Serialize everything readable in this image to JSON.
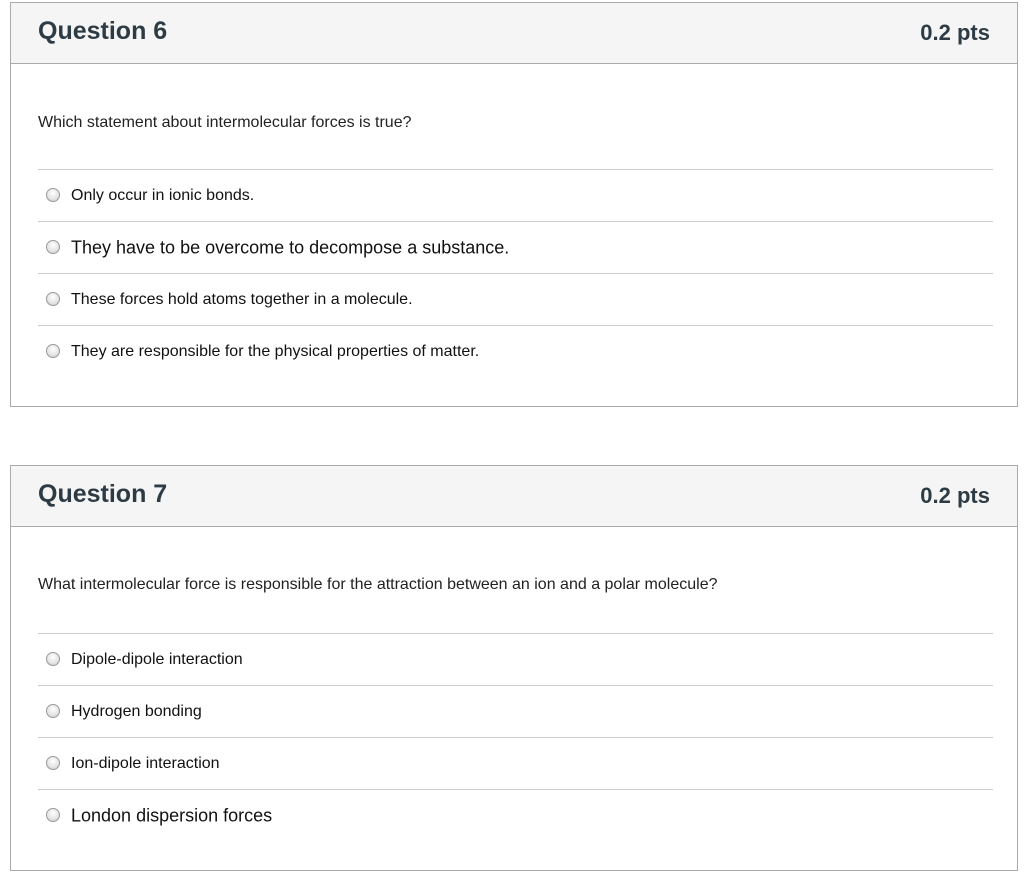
{
  "questions": [
    {
      "title": "Question 6",
      "points": "0.2 pts",
      "text": "Which statement about intermolecular forces is true?",
      "answers": [
        "Only occur in ionic bonds.",
        "They have to be overcome to decompose a substance.",
        "These forces hold atoms together in a molecule.",
        "They are responsible for the physical properties of matter."
      ]
    },
    {
      "title": "Question 7",
      "points": "0.2 pts",
      "text": "What intermolecular force is responsible for the attraction between an ion and a polar molecule?",
      "answers": [
        "Dipole-dipole interaction",
        "Hydrogen bonding",
        "Ion-dipole interaction",
        "London dispersion forces"
      ]
    }
  ]
}
